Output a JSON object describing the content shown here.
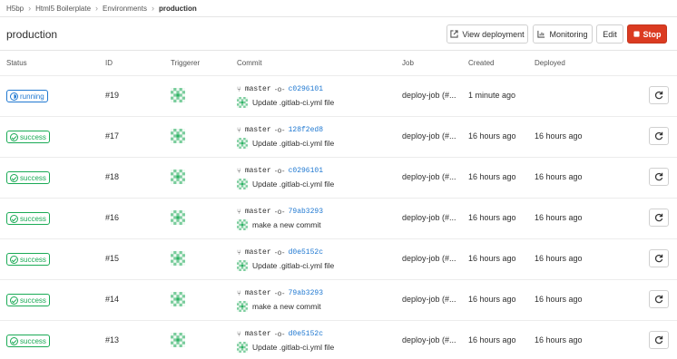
{
  "breadcrumb": [
    "H5bp",
    "Html5 Boilerplate",
    "Environments",
    "production"
  ],
  "title": "production",
  "buttons": {
    "view_deployment": "View deployment",
    "monitoring": "Monitoring",
    "edit": "Edit",
    "stop": "Stop"
  },
  "columns": [
    "Status",
    "ID",
    "Triggerer",
    "Commit",
    "Job",
    "Created",
    "Deployed"
  ],
  "colors": {
    "running": "#1f78d1",
    "success": "#1aaa55",
    "stop": "#db3b21",
    "link": "#1f78d1"
  },
  "deployments": [
    {
      "status": "running",
      "id": "#19",
      "branch": "master",
      "sha": "c0296101",
      "message": "Update .gitlab-ci.yml file",
      "job": "deploy-job (#...",
      "created": "1 minute ago",
      "deployed": ""
    },
    {
      "status": "success",
      "id": "#17",
      "branch": "master",
      "sha": "128f2ed8",
      "message": "Update .gitlab-ci.yml file",
      "job": "deploy-job (#...",
      "created": "16 hours ago",
      "deployed": "16 hours ago"
    },
    {
      "status": "success",
      "id": "#18",
      "branch": "master",
      "sha": "c0296101",
      "message": "Update .gitlab-ci.yml file",
      "job": "deploy-job (#...",
      "created": "16 hours ago",
      "deployed": "16 hours ago"
    },
    {
      "status": "success",
      "id": "#16",
      "branch": "master",
      "sha": "79ab3293",
      "message": "make a new commit",
      "job": "deploy-job (#...",
      "created": "16 hours ago",
      "deployed": "16 hours ago"
    },
    {
      "status": "success",
      "id": "#15",
      "branch": "master",
      "sha": "d0e5152c",
      "message": "Update .gitlab-ci.yml file",
      "job": "deploy-job (#...",
      "created": "16 hours ago",
      "deployed": "16 hours ago"
    },
    {
      "status": "success",
      "id": "#14",
      "branch": "master",
      "sha": "79ab3293",
      "message": "make a new commit",
      "job": "deploy-job (#...",
      "created": "16 hours ago",
      "deployed": "16 hours ago"
    },
    {
      "status": "success",
      "id": "#13",
      "branch": "master",
      "sha": "d0e5152c",
      "message": "Update .gitlab-ci.yml file",
      "job": "deploy-job (#...",
      "created": "16 hours ago",
      "deployed": "16 hours ago"
    }
  ]
}
